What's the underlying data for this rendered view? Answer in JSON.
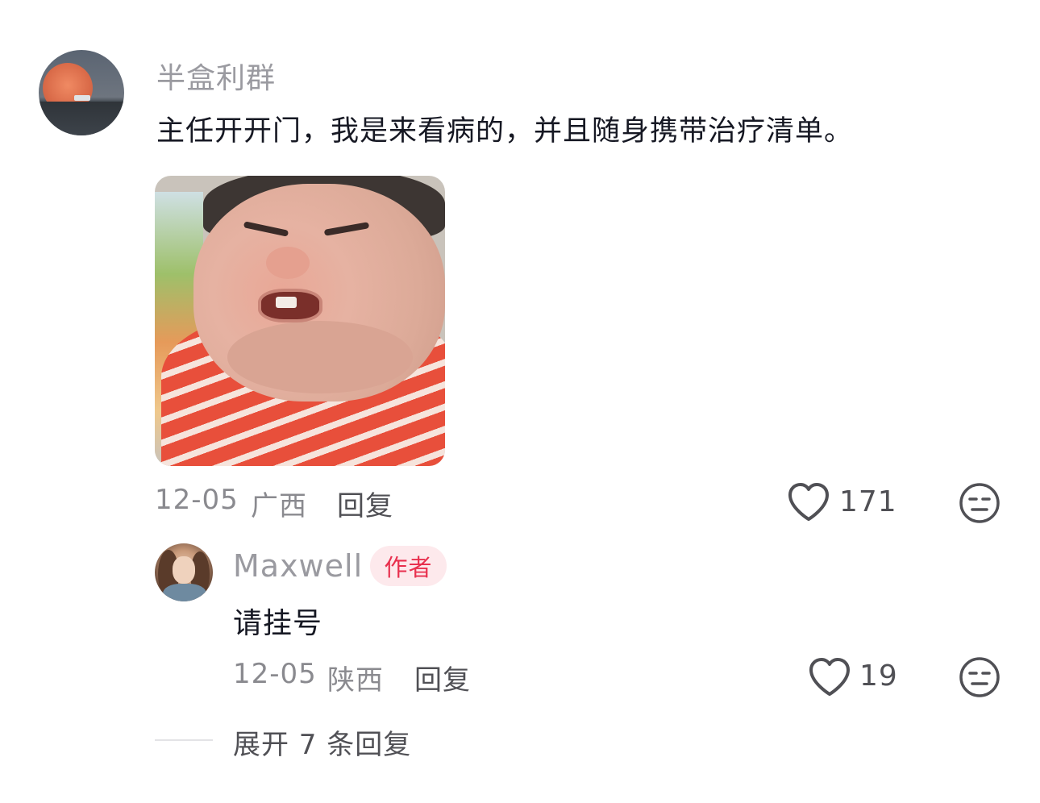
{
  "comment": {
    "username": "半盒利群",
    "text": "主任开开门，我是来看病的，并且随身携带治疗清单。",
    "date": "12-05",
    "location": "广西",
    "reply_label": "回复",
    "like_count": "171"
  },
  "reply": {
    "username": "Maxwell",
    "badge": "作者",
    "text": "请挂号",
    "date": "12-05",
    "location": "陕西",
    "reply_label": "回复",
    "like_count": "19"
  },
  "expand": {
    "label": "展开 7 条回复"
  },
  "icons": {
    "like": "heart-outline-icon",
    "dislike": "meh-face-icon"
  },
  "colors": {
    "badge_bg": "#fde9ec",
    "badge_text": "#e8304e",
    "muted_text": "#8a8a8f",
    "primary_text": "#161823"
  }
}
